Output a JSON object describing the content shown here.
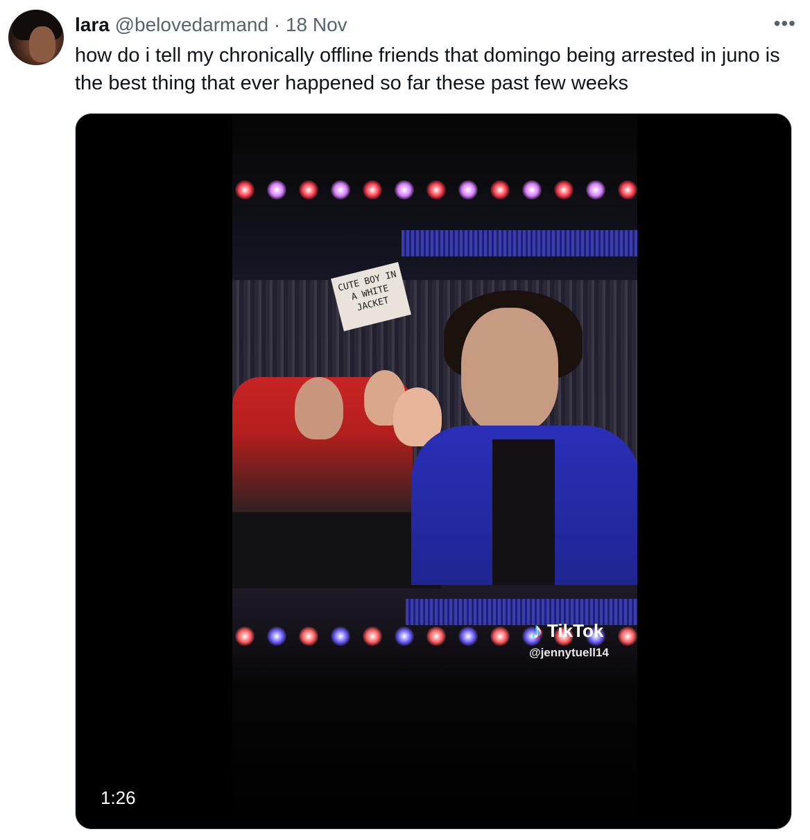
{
  "tweet": {
    "author_name": "lara",
    "author_handle": "@belovedarmand",
    "separator": "·",
    "date": "18 Nov",
    "more_icon": "more-horizontal-icon",
    "text": "how do i tell my chronically offline friends that domingo being arrested in juno is the best thing that ever happened so far these past few weeks"
  },
  "media": {
    "type": "video",
    "duration": "1:26",
    "sign_text": "CUTE BOY IN A WHITE JACKET",
    "watermark": {
      "brand": "TikTok",
      "icon": "tiktok-note-icon",
      "handle": "@jennytuell14"
    }
  },
  "colors": {
    "text_primary": "#0f1419",
    "text_secondary": "#536471",
    "border": "#cfd9de",
    "video_bg": "#000000"
  }
}
